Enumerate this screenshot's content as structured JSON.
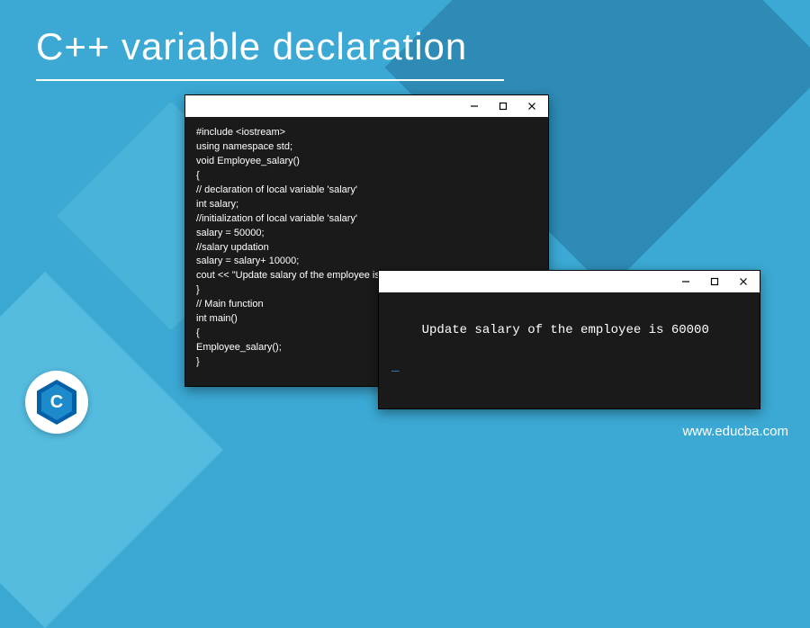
{
  "page_title": "C++ variable declaration",
  "code_window": {
    "code": "#include <iostream>\nusing namespace std;\nvoid Employee_salary()\n{\n// declaration of local variable 'salary'\nint salary;\n//initialization of local variable 'salary'\nsalary = 50000;\n//salary updation\nsalary = salary+ 10000;\ncout << \"Update salary of the employee is \" << salary;\n}\n// Main function\nint main()\n{\nEmployee_salary();\n}"
  },
  "output_window": {
    "output": "Update salary of the employee is 60000"
  },
  "logo": {
    "text": "C"
  },
  "site_url": "www.educba.com"
}
